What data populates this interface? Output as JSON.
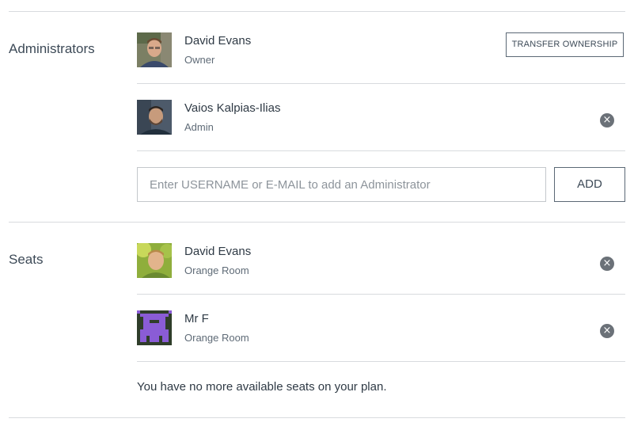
{
  "administrators": {
    "section_label": "Administrators",
    "transfer_button": "TRANSFER OWNERSHIP",
    "members": [
      {
        "name": "David Evans",
        "role": "Owner",
        "avatar": "photo-avatar"
      },
      {
        "name": "Vaios Kalpias-Ilias",
        "role": "Admin",
        "avatar": "photo-avatar",
        "remove_icon": "×"
      }
    ],
    "input": {
      "placeholder": "Enter USERNAME or E-MAIL to add an Administrator",
      "value": ""
    },
    "add_button": "ADD"
  },
  "seats": {
    "section_label": "Seats",
    "members": [
      {
        "name": "David Evans",
        "room": "Orange Room",
        "avatar": "photo-avatar",
        "remove_icon": "×"
      },
      {
        "name": "Mr F",
        "room": "Orange Room",
        "avatar": "pixel-monster-avatar",
        "remove_icon": "×"
      }
    ],
    "note": "You have no more available seats on your plan."
  },
  "colors": {
    "divider": "#d8dbde",
    "text": "#2f3a45",
    "muted": "#5f6b77",
    "remove_bg": "#6b7178",
    "pixel_avatar_fg": "#8a5cd6",
    "pixel_avatar_bg": "#2f3d2a"
  }
}
